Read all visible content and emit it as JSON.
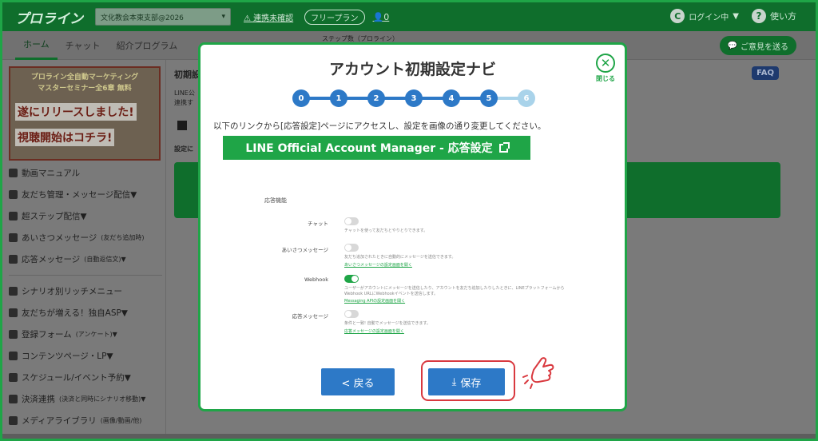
{
  "app": {
    "logo": "プロライン",
    "account_select": "文化教会本東支部@2026",
    "unconfirmed_link": "⚠ 連携未確認",
    "plan_badge": "フリープラン",
    "user_count": "0",
    "login_status": "ログイン中",
    "avatar_letter": "C",
    "help_label": "使い方",
    "help_symbol": "?"
  },
  "tabs": [
    {
      "label": "ホーム",
      "active": true
    },
    {
      "label": "チャット",
      "active": false
    },
    {
      "label": "紹介プログラム",
      "active": false
    }
  ],
  "step_count_label": "ステップ数（プロライン）",
  "feedback_button": "ご意見を送る",
  "banner": {
    "line1": "プロライン全自動マーケティング",
    "line2": "マスターセミナー全6章 無料",
    "line3": "遂にリリースしました!",
    "line4": "視聴開始はコチラ!"
  },
  "sidebar": {
    "items": [
      {
        "label": "動画マニュアル",
        "small": ""
      },
      {
        "label": "友だち管理・メッセージ配信▼",
        "small": ""
      },
      {
        "label": "超ステップ配信▼",
        "small": ""
      },
      {
        "label": "あいさつメッセージ",
        "small": "(友だち追加時)"
      },
      {
        "label": "応答メッセージ",
        "small": "(自動返信文)▼"
      },
      {
        "label": "シナリオ別リッチメニュー",
        "small": ""
      },
      {
        "label": "友だちが増える！独自ASP▼",
        "small": ""
      },
      {
        "label": "登録フォーム",
        "small": "(アンケート)▼"
      },
      {
        "label": "コンテンツページ・LP▼",
        "small": ""
      },
      {
        "label": "スケジュール/イベント予約▼",
        "small": ""
      },
      {
        "label": "決済連携",
        "small": "(決済と同時にシナリオ移動)▼"
      },
      {
        "label": "メディアライブラリ",
        "small": "(画像/動画/他)"
      }
    ]
  },
  "main": {
    "title": "初期設",
    "text1": "LINE公",
    "text2": "連携す",
    "text3": "設定に",
    "faq": "FAQ"
  },
  "modal": {
    "title": "アカウント初期設定ナビ",
    "close_label": "閉じる",
    "close_symbol": "✕",
    "steps": [
      "0",
      "1",
      "2",
      "3",
      "4",
      "5",
      "6"
    ],
    "current_step": 5,
    "instruction": "以下のリンクから[応答設定]ページにアクセスし、設定を画像の通り変更してください。",
    "link_button": "LINE Official Account Manager - 応答設定",
    "back_button": "< 戻る",
    "save_button": "保存",
    "save_icon": "⤓"
  },
  "settings_screenshot": {
    "title": "応答機能",
    "rows": [
      {
        "label": "チャット",
        "on": false,
        "desc": "チャットを使って友だちとやりとりできます。",
        "desc2": "",
        "link": ""
      },
      {
        "label": "あいさつメッセージ",
        "on": false,
        "desc": "友だち追加されたときに自動的にメッセージを送信できます。",
        "desc2": "",
        "link": "あいさつメッセージの設定画面を開く"
      },
      {
        "label": "Webhook",
        "on": true,
        "desc": "ユーザーがアカウントにメッセージを送信したり、アカウントを友だち追加したりしたときに、LINEプラットフォームから",
        "desc2": "Webhook URLにWebhookイベントを送信します。",
        "link": "Messaging APIの設定画面を開く"
      },
      {
        "label": "応答メッセージ",
        "on": false,
        "desc": "条件と一致!                                    自動でメッセージを送信できます。",
        "desc2": "",
        "link": "応答メッセージの設定画面を開く"
      }
    ]
  },
  "colors": {
    "brand_green": "#1fa547",
    "step_done": "#2d79c7",
    "step_pending": "#a9d3ea",
    "button_blue": "#2d79c7",
    "highlight_red": "#d9393f"
  }
}
